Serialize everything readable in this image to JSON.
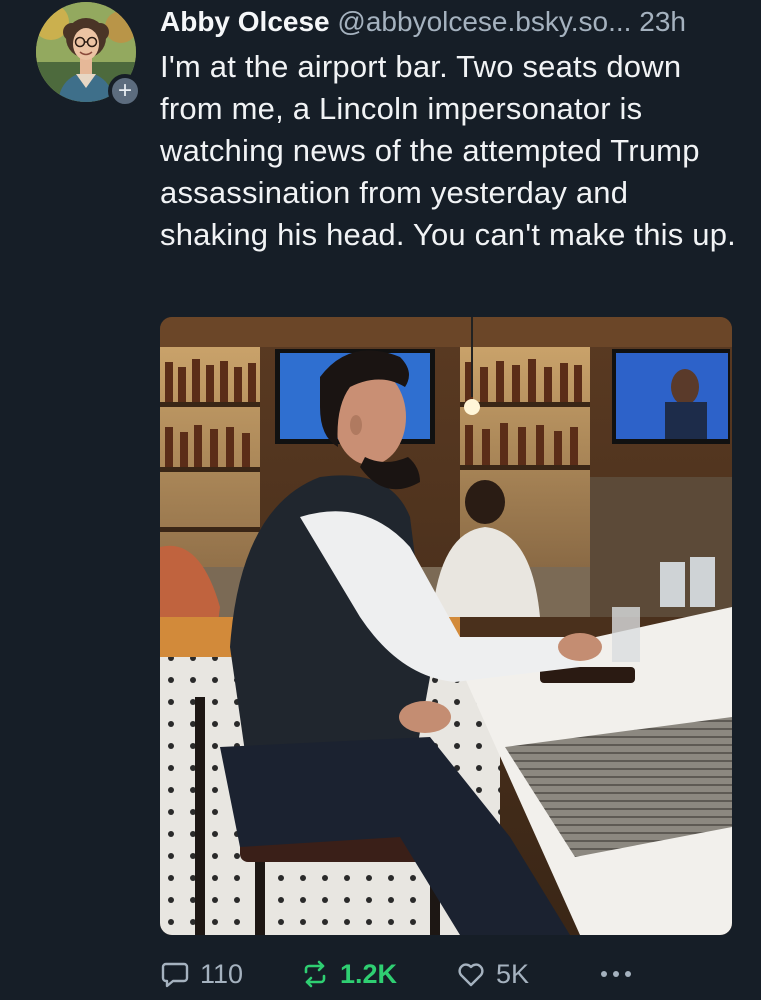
{
  "post": {
    "author": {
      "display_name": "Abby Olcese",
      "handle": "@abbyolcese.bsky.so...",
      "timestamp": "23h"
    },
    "text": "I'm at the airport bar. Two seats down from me, a Lincoln impersonator is watching news of the attempted Trump assassination from yesterday and shaking his head. You can't make this up.",
    "actions": {
      "reply_count": "110",
      "repost_count": "1.2K",
      "like_count": "5K"
    }
  },
  "icons": {
    "follow": "plus-icon",
    "reply": "speech-bubble-icon",
    "repost": "repost-arrows-icon",
    "like": "heart-icon",
    "more": "ellipsis-icon"
  },
  "colors": {
    "background": "#161e27",
    "text": "#f1f3f5",
    "muted": "#a5b2bf",
    "repost_active": "#2fcf72"
  }
}
